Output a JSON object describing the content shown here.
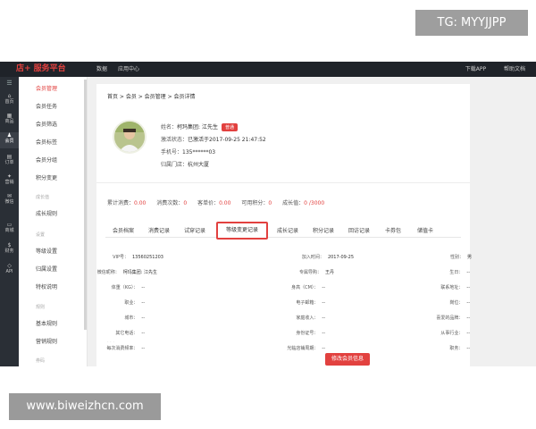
{
  "overlay": {
    "tg": "TG: MYYJJPP",
    "url": "www.biweizhcn.com"
  },
  "topbar": {
    "brand": "店+ 服务平台",
    "nav": [
      "数据",
      "应用中心"
    ],
    "right": [
      "下载APP",
      "帮助文档"
    ]
  },
  "iconbar": [
    {
      "glyph": "⌂",
      "label": "首页"
    },
    {
      "glyph": "▦",
      "label": "商品"
    },
    {
      "glyph": "♟",
      "label": "会员",
      "active": true
    },
    {
      "glyph": "▤",
      "label": "订单"
    },
    {
      "glyph": "✦",
      "label": "营销"
    },
    {
      "glyph": "✉",
      "label": "微信"
    },
    {
      "glyph": "▭",
      "label": "商城"
    },
    {
      "glyph": "$",
      "label": "财务"
    },
    {
      "glyph": "◇",
      "label": "API"
    }
  ],
  "submenu": {
    "items": [
      {
        "label": "会员管理",
        "active": true
      },
      {
        "label": "会员任务"
      },
      {
        "label": "会员筛选"
      },
      {
        "label": "会员标签"
      },
      {
        "label": "会员分组"
      },
      {
        "label": "积分变更"
      },
      {
        "label": "成长值",
        "group": true
      },
      {
        "label": "成长规则"
      },
      {
        "label": "设置",
        "group": true
      },
      {
        "label": "等级设置"
      },
      {
        "label": "归属设置"
      },
      {
        "label": "特权说明"
      },
      {
        "label": "规则",
        "group": true
      },
      {
        "label": "基本规则"
      },
      {
        "label": "营销规则"
      },
      {
        "label": "券码",
        "group": true
      }
    ]
  },
  "breadcrumb": "首页 > 会员 > 会员管理 > 会员详情",
  "profile": {
    "name_label": "姓名：",
    "name_value": "柯玛集团: 江先生",
    "level_badge": "普通",
    "status_label": "激活状态：",
    "status_value": "已激活于2017-09-25 21:47:52",
    "phone_label": "手机号：",
    "phone_value": "135******03",
    "store_label": "归属门店：",
    "store_value": "杭州大厦"
  },
  "stats": [
    {
      "label": "累计消费：",
      "value": "0.00"
    },
    {
      "label": "消费次数：",
      "value": "0"
    },
    {
      "label": "客单价：",
      "value": "0.00"
    },
    {
      "label": "可用积分：",
      "value": "0"
    },
    {
      "label": "成长值：",
      "value": "0 /3000"
    }
  ],
  "tabs": [
    {
      "label": "会员档案"
    },
    {
      "label": "消费记录"
    },
    {
      "label": "试穿记录"
    },
    {
      "label": "等级变更记录",
      "active": true
    },
    {
      "label": "成长记录"
    },
    {
      "label": "积分记录"
    },
    {
      "label": "回访记录"
    },
    {
      "label": "卡券包"
    },
    {
      "label": "储值卡"
    }
  ],
  "fields": {
    "col1": [
      {
        "label": "VIP号：",
        "value": "13560251203"
      },
      {
        "label": "微信昵称：",
        "value": "柯玛集团: 江先生"
      },
      {
        "label": "体重（KG）：",
        "value": "--"
      },
      {
        "label": "职业：",
        "value": "--"
      },
      {
        "label": "城市：",
        "value": "--"
      },
      {
        "label": "其它电话：",
        "value": "--"
      },
      {
        "label": "每次消费频率：",
        "value": "--"
      }
    ],
    "col2": [
      {
        "label": "加入时间：",
        "value": "2017-09-25"
      },
      {
        "label": "专属导购：",
        "value": "王丹"
      },
      {
        "label": "身高（CM）：",
        "value": "--"
      },
      {
        "label": "电子邮箱：",
        "value": "--"
      },
      {
        "label": "家庭收入：",
        "value": "--"
      },
      {
        "label": "身份证号：",
        "value": "--"
      },
      {
        "label": "光临店铺周期：",
        "value": "--"
      }
    ],
    "col3": [
      {
        "label": "性别：",
        "value": "男"
      },
      {
        "label": "生日：",
        "value": "--"
      },
      {
        "label": "联系地址：",
        "value": "--"
      },
      {
        "label": "岗位：",
        "value": "--"
      },
      {
        "label": "喜爱的品牌：",
        "value": "--"
      },
      {
        "label": "从事行业：",
        "value": "--"
      },
      {
        "label": "职务：",
        "value": "--"
      }
    ]
  },
  "actions": {
    "edit_button": "修改会员信息"
  }
}
